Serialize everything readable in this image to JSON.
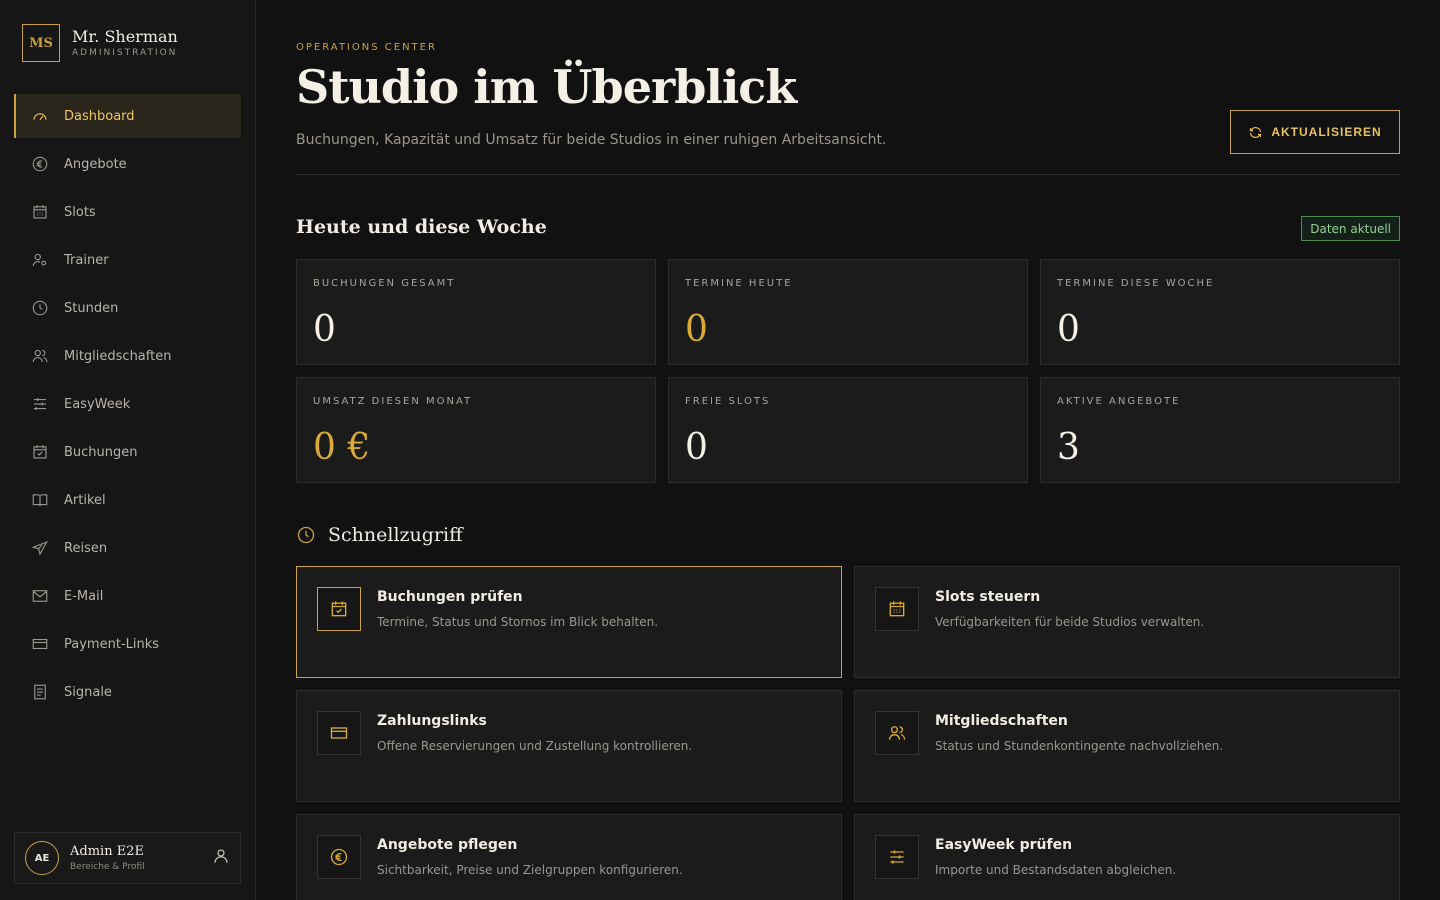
{
  "brand": {
    "initials": "MS",
    "name": "Mr. Sherman",
    "subtitle": "ADMINISTRATION"
  },
  "sidebar": {
    "items": [
      {
        "label": "Dashboard",
        "icon": "gauge-icon",
        "active": true
      },
      {
        "label": "Angebote",
        "icon": "euro-icon"
      },
      {
        "label": "Slots",
        "icon": "calendar-grid-icon"
      },
      {
        "label": "Trainer",
        "icon": "user-gear-icon"
      },
      {
        "label": "Stunden",
        "icon": "clock-icon"
      },
      {
        "label": "Mitgliedschaften",
        "icon": "users-icon"
      },
      {
        "label": "EasyWeek",
        "icon": "sliders-icon"
      },
      {
        "label": "Buchungen",
        "icon": "calendar-check-icon"
      },
      {
        "label": "Artikel",
        "icon": "book-icon"
      },
      {
        "label": "Reisen",
        "icon": "plane-icon"
      },
      {
        "label": "E-Mail",
        "icon": "mail-icon"
      },
      {
        "label": "Payment-Links",
        "icon": "credit-card-icon"
      },
      {
        "label": "Signale",
        "icon": "document-icon"
      }
    ]
  },
  "user": {
    "initials": "AE",
    "name": "Admin E2E",
    "subtitle": "Bereiche & Profil"
  },
  "header": {
    "eyebrow": "OPERATIONS CENTER",
    "title": "Studio im Überblick",
    "subtitle": "Buchungen, Kapazität und Umsatz für beide Studios in einer ruhigen Arbeitsansicht.",
    "refresh_label": "AKTUALISIEREN"
  },
  "today": {
    "title": "Heute und diese Woche",
    "badge": "Daten aktuell",
    "badge_color": "#8fd18f",
    "stats": [
      {
        "label": "BUCHUNGEN GESAMT",
        "value": "0"
      },
      {
        "label": "TERMINE HEUTE",
        "value": "0",
        "accent": true
      },
      {
        "label": "TERMINE DIESE WOCHE",
        "value": "0"
      },
      {
        "label": "UMSATZ DIESEN MONAT",
        "value": "0 €",
        "accent": true
      },
      {
        "label": "FREIE SLOTS",
        "value": "0"
      },
      {
        "label": "AKTIVE ANGEBOTE",
        "value": "3"
      }
    ]
  },
  "quick": {
    "title": "Schnellzugriff",
    "cards": [
      {
        "title": "Buchungen prüfen",
        "desc": "Termine, Status und Stornos im Blick behalten.",
        "icon": "calendar-check-icon",
        "active": true
      },
      {
        "title": "Slots steuern",
        "desc": "Verfügbarkeiten für beide Studios verwalten.",
        "icon": "calendar-grid-icon"
      },
      {
        "title": "Zahlungslinks",
        "desc": "Offene Reservierungen und Zustellung kontrollieren.",
        "icon": "credit-card-icon"
      },
      {
        "title": "Mitgliedschaften",
        "desc": "Status und Stundenkontingente nachvollziehen.",
        "icon": "users-icon"
      },
      {
        "title": "Angebote pflegen",
        "desc": "Sichtbarkeit, Preise und Zielgruppen konfigurieren.",
        "icon": "euro-icon"
      },
      {
        "title": "EasyWeek prüfen",
        "desc": "Importe und Bestandsdaten abgleichen.",
        "icon": "sliders-icon"
      }
    ]
  },
  "colors": {
    "accent": "#c9a23a",
    "background": "#111111",
    "surface": "#1b1b1b"
  }
}
